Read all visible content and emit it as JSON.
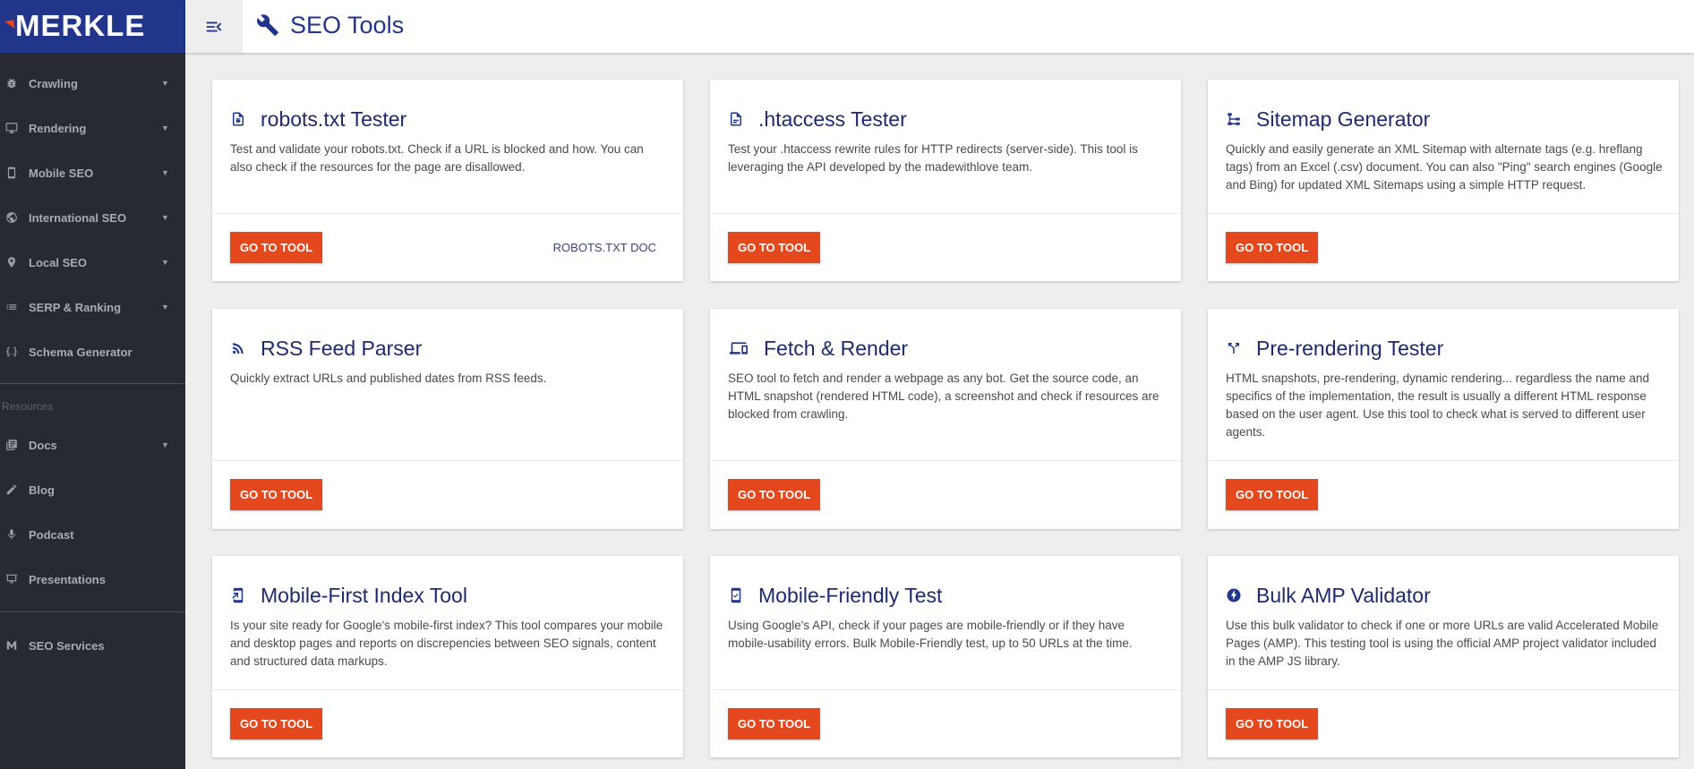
{
  "logo": {
    "text": "MERKLE"
  },
  "header": {
    "title": "SEO Tools"
  },
  "sidebar": {
    "items": [
      {
        "label": "Crawling",
        "icon": "bug-icon",
        "has_chevron": true
      },
      {
        "label": "Rendering",
        "icon": "monitor-icon",
        "has_chevron": true
      },
      {
        "label": "Mobile SEO",
        "icon": "phone-icon",
        "has_chevron": true
      },
      {
        "label": "International SEO",
        "icon": "globe-icon",
        "has_chevron": true
      },
      {
        "label": "Local SEO",
        "icon": "map-pin-icon",
        "has_chevron": true
      },
      {
        "label": "SERP & Ranking",
        "icon": "list-icon",
        "has_chevron": true
      },
      {
        "label": "Schema Generator",
        "icon": "code-braces-icon",
        "has_chevron": false
      }
    ],
    "resources_heading": "Resources",
    "resources": [
      {
        "label": "Docs",
        "icon": "book-icon",
        "has_chevron": true
      },
      {
        "label": "Blog",
        "icon": "pencil-icon",
        "has_chevron": false
      },
      {
        "label": "Podcast",
        "icon": "microphone-icon",
        "has_chevron": false
      },
      {
        "label": "Presentations",
        "icon": "presentation-icon",
        "has_chevron": false
      }
    ],
    "services": {
      "label": "SEO Services",
      "icon": "merkle-m-icon"
    }
  },
  "cards": [
    {
      "title": "robots.txt Tester",
      "icon": "robot-file-icon",
      "description": "Test and validate your robots.txt. Check if a URL is blocked and how. You can also check if the resources for the page are disallowed.",
      "button": "GO TO TOOL",
      "secondary": "ROBOTS.TXT DOC"
    },
    {
      "title": ".htaccess Tester",
      "icon": "file-icon",
      "description": "Test your .htaccess rewrite rules for HTTP redirects (server-side). This tool is leveraging the API developed by the madewithlove team.",
      "button": "GO TO TOOL"
    },
    {
      "title": "Sitemap Generator",
      "icon": "sitemap-icon",
      "description": "Quickly and easily generate an XML Sitemap with alternate tags (e.g. hreflang tags) from an Excel (.csv) document. You can also \"Ping\" search engines (Google and Bing) for updated XML Sitemaps using a simple HTTP request.",
      "button": "GO TO TOOL"
    },
    {
      "title": "RSS Feed Parser",
      "icon": "rss-icon",
      "description": "Quickly extract URLs and published dates from RSS feeds.",
      "button": "GO TO TOOL"
    },
    {
      "title": "Fetch & Render",
      "icon": "devices-icon",
      "description": "SEO tool to fetch and render a webpage as any bot. Get the source code, an HTML snapshot (rendered HTML code), a screenshot and check if resources are blocked from crawling.",
      "button": "GO TO TOOL"
    },
    {
      "title": "Pre-rendering Tester",
      "icon": "call-split-icon",
      "description": "HTML snapshots, pre-rendering, dynamic rendering... regardless the name and specifics of the implementation, the result is usually a different HTML response based on the user agent. Use this tool to check what is served to different user agents.",
      "button": "GO TO TOOL"
    },
    {
      "title": "Mobile-First Index Tool",
      "icon": "mobile-arrow-icon",
      "description": "Is your site ready for Google's mobile-first index? This tool compares your mobile and desktop pages and reports on discrepencies between SEO signals, content and structured data markups.",
      "button": "GO TO TOOL"
    },
    {
      "title": "Mobile-Friendly Test",
      "icon": "mobile-check-icon",
      "description": "Using Google's API, check if your pages are mobile-friendly or if they have mobile-usability errors. Bulk Mobile-Friendly test, up to 50 URLs at the time.",
      "button": "GO TO TOOL"
    },
    {
      "title": "Bulk AMP Validator",
      "icon": "amp-bolt-icon",
      "description": "Use this bulk validator to check if one or more URLs are valid Accelerated Mobile Pages (AMP). This testing tool is using the official AMP project validator included in the AMP JS library.",
      "button": "GO TO TOOL"
    }
  ],
  "colors": {
    "brand": "#21358a",
    "sidebar": "#272a33",
    "button": "#e5481c"
  }
}
